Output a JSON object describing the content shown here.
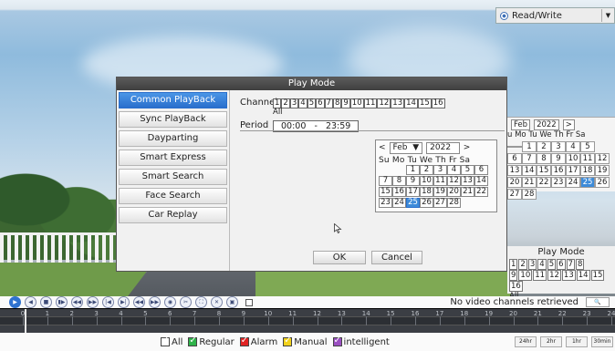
{
  "right_panel": {
    "mode_label": "Read/Write",
    "cal": {
      "month": "Feb",
      "year": "2022",
      "dow": "u Mo Tu We Th  Fr  Sa",
      "rows": [
        [
          "1",
          "2",
          "3",
          "4",
          "5"
        ],
        [
          "7",
          "8",
          "9",
          "10",
          "11",
          "12"
        ],
        [
          "14",
          "15",
          "16",
          "17",
          "18",
          "19"
        ],
        [
          "21",
          "22",
          "23",
          "24",
          "25",
          "26"
        ],
        [
          "28"
        ]
      ],
      "row_prefix": [
        "",
        "6",
        "13",
        "20",
        "27"
      ]
    },
    "play_mode_title": "Play Mode",
    "channels_r1": [
      "1",
      "2",
      "3",
      "4",
      "5",
      "6",
      "7",
      "8"
    ],
    "channels_r2": [
      "9",
      "10",
      "11",
      "12",
      "13",
      "14",
      "15",
      "16"
    ],
    "all_label": "All"
  },
  "dialog": {
    "title": "Play Mode",
    "menu": [
      "Common PlayBack",
      "Sync PlayBack",
      "Dayparting",
      "Smart Express",
      "Smart Search",
      "Face Search",
      "Car Replay"
    ],
    "active_index": 0,
    "channel_label": "Channel",
    "channels": [
      "1",
      "2",
      "3",
      "4",
      "5",
      "6",
      "7",
      "8",
      "9",
      "10",
      "11",
      "12",
      "13",
      "14",
      "15",
      "16"
    ],
    "all_label": "All",
    "period_label": "Period",
    "period_start": "00:00",
    "period_sep": "-",
    "period_end": "23:59",
    "calendar": {
      "prev": "<",
      "next": ">",
      "month": "Feb",
      "year": "2022",
      "dow": "Su Mo Tu We Th  Fr  Sa",
      "selected_day": "25"
    },
    "ok_label": "OK",
    "cancel_label": "Cancel"
  },
  "controls": {
    "status": "No video channels retrieved"
  },
  "timeline": {
    "hours": [
      "0",
      "1",
      "2",
      "3",
      "4",
      "5",
      "6",
      "7",
      "8",
      "9",
      "10",
      "11",
      "12",
      "13",
      "14",
      "15",
      "16",
      "17",
      "18",
      "19",
      "20",
      "21",
      "22",
      "23",
      "24"
    ]
  },
  "legend": {
    "items": [
      {
        "label": "All",
        "color": "#ffffff"
      },
      {
        "label": "Regular",
        "color": "#2fb34a"
      },
      {
        "label": "Alarm",
        "color": "#e02424"
      },
      {
        "label": "Manual",
        "color": "#f2d21b"
      },
      {
        "label": "intelligent",
        "color": "#9b4fc2"
      }
    ],
    "ranges": [
      "24hr",
      "2hr",
      "1hr",
      "30min"
    ]
  },
  "colors": {
    "accent": "#2a6fcc",
    "dialog_title": "#3f3f3f"
  }
}
